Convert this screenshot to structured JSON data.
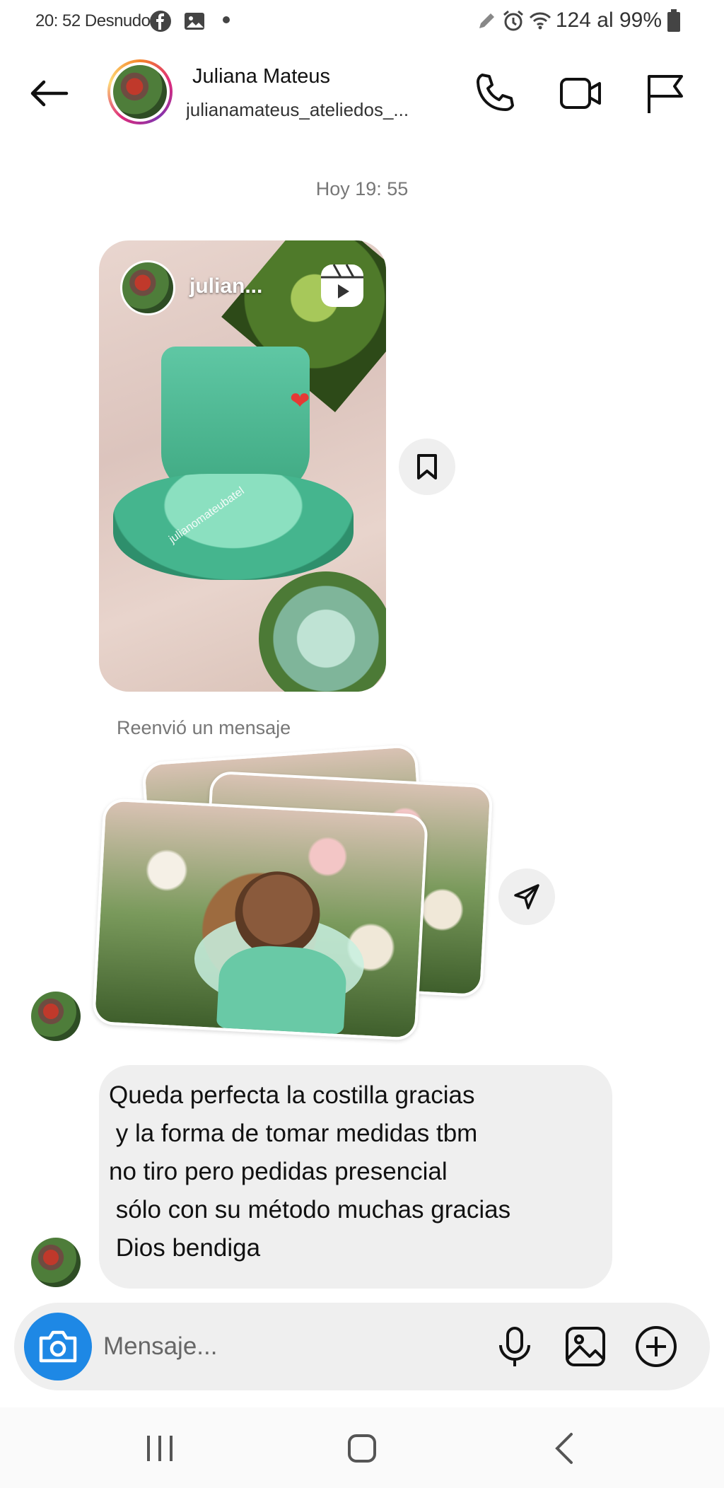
{
  "status_bar": {
    "time": "20: 52 Desnudo",
    "signal": "124 al 99%"
  },
  "header": {
    "name": "Juliana Mateus",
    "handle": "julianamateus_ateliedos_..."
  },
  "thread": {
    "day_stamp": "Hoy 19: 55",
    "reel": {
      "owner": "julian...",
      "watermark": "julianomateubatel"
    },
    "forward_label": "Reenvió un mensaje",
    "message_lines": [
      "Queda perfecta la costilla gracias",
      " y la forma de tomar medidas tbm",
      "no tiro pero pedidas presencial",
      " sólo con su método muchas gracias",
      " Dios bendiga"
    ]
  },
  "composer": {
    "placeholder": "Mensaje..."
  },
  "colors": {
    "accent": "#1e88e5",
    "bubble": "#efefef",
    "muted_text": "#777777"
  },
  "icons": [
    "facebook-icon",
    "gallery-icon",
    "edit-icon",
    "alarm-icon",
    "wifi-icon",
    "battery-icon",
    "back-arrow-icon",
    "phone-icon",
    "video-icon",
    "flag-icon",
    "reel-icon",
    "bookmark-icon",
    "send-icon",
    "camera-icon",
    "microphone-icon",
    "image-icon",
    "plus-circle-icon",
    "recents-icon",
    "home-icon",
    "nav-back-icon"
  ]
}
